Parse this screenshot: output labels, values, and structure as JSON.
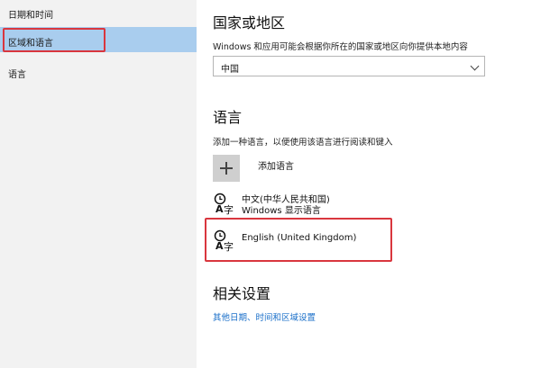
{
  "sidebar": {
    "items": [
      {
        "label": "日期和时间"
      },
      {
        "label": "区域和语言"
      },
      {
        "label": "语言"
      }
    ],
    "selected_color": "#a9cdee"
  },
  "region": {
    "heading": "国家或地区",
    "description": "Windows 和应用可能会根据你所在的国家或地区向你提供本地内容",
    "selected": "中国"
  },
  "language": {
    "heading": "语言",
    "description": "添加一种语言，以便使用该语言进行阅读和键入",
    "add_label": "添加语言",
    "items": [
      {
        "name": "中文(中华人民共和国)",
        "sub": "Windows 显示语言"
      },
      {
        "name": "English (United Kingdom)",
        "sub": ""
      }
    ]
  },
  "related": {
    "heading": "相关设置",
    "link": "其他日期、时间和区域设置"
  },
  "colors": {
    "highlight_border": "#d9363e",
    "link": "#1a6fc9"
  },
  "icons": {
    "language": "language-icon",
    "add": "plus-icon",
    "dropdown": "chevron-down-icon"
  }
}
